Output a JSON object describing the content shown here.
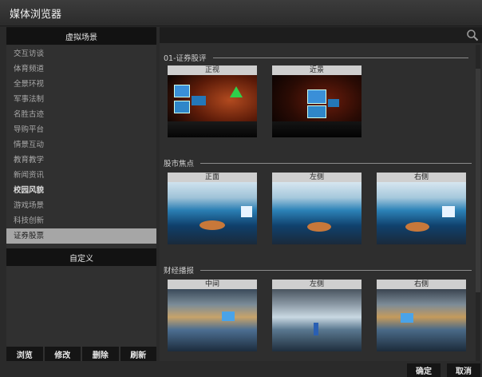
{
  "window": {
    "title": "媒体浏览器"
  },
  "sidebar": {
    "header": "虚拟场景",
    "categories": [
      {
        "label": "交互访谈"
      },
      {
        "label": "体育频道"
      },
      {
        "label": "全景环视"
      },
      {
        "label": "军事法制"
      },
      {
        "label": "名胜古迹"
      },
      {
        "label": "导购平台"
      },
      {
        "label": "情景互动"
      },
      {
        "label": "教育教学"
      },
      {
        "label": "新闻资讯"
      },
      {
        "label": "校园风貌"
      },
      {
        "label": "游戏场景"
      },
      {
        "label": "科技创新"
      },
      {
        "label": "证券股票"
      }
    ],
    "custom_header": "自定义",
    "buttons": {
      "browse": "浏览",
      "edit": "修改",
      "delete": "删除",
      "refresh": "刷新"
    }
  },
  "search": {
    "placeholder": "",
    "icon": "search-icon"
  },
  "sections": [
    {
      "title": "01-证券股评",
      "items": [
        {
          "caption": "正视"
        },
        {
          "caption": "近景"
        }
      ]
    },
    {
      "title": "股市焦点",
      "items": [
        {
          "caption": "正面"
        },
        {
          "caption": "左侧"
        },
        {
          "caption": "右侧"
        }
      ]
    },
    {
      "title": "财经播报",
      "items": [
        {
          "caption": "中间"
        },
        {
          "caption": "左侧"
        },
        {
          "caption": "右侧"
        }
      ]
    }
  ],
  "footer": {
    "ok": "确定",
    "cancel": "取消"
  },
  "colors": {
    "selected": "#a6a6a6",
    "panel": "#303030",
    "header": "#121212"
  }
}
